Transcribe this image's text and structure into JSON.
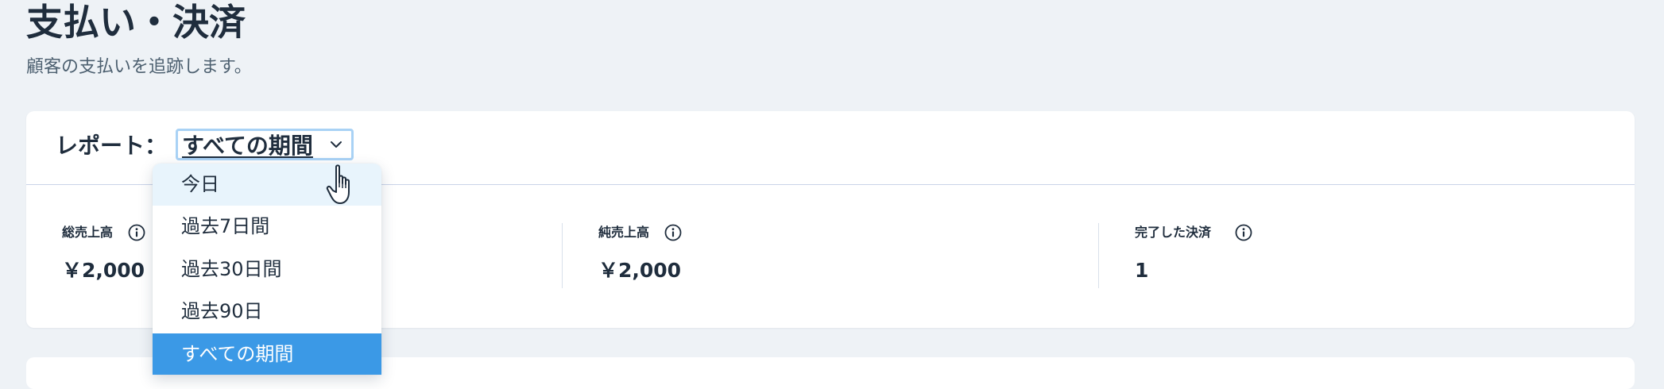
{
  "header": {
    "title": "支払い・決済",
    "subtitle": "顧客の支払いを追跡します。"
  },
  "report": {
    "label": "レポート：",
    "selected_period": "すべての期間",
    "options": [
      "今日",
      "過去7日間",
      "過去30日間",
      "過去90日",
      "すべての期間"
    ],
    "hovered_option": "今日"
  },
  "stats": [
    {
      "label": "総売上高",
      "value": "￥2,000"
    },
    {
      "label": "純売上高",
      "value": "￥2,000"
    },
    {
      "label": "完了した決済",
      "value": "1"
    }
  ],
  "colors": {
    "selected_option_bg": "#3b99e6",
    "hovered_option_bg": "#e8f4fc",
    "select_focus_border": "#a9d2f5",
    "page_bg": "#eef2f6"
  },
  "icons": [
    "info-icon",
    "chevron-down-icon",
    "hand-pointer-cursor"
  ]
}
